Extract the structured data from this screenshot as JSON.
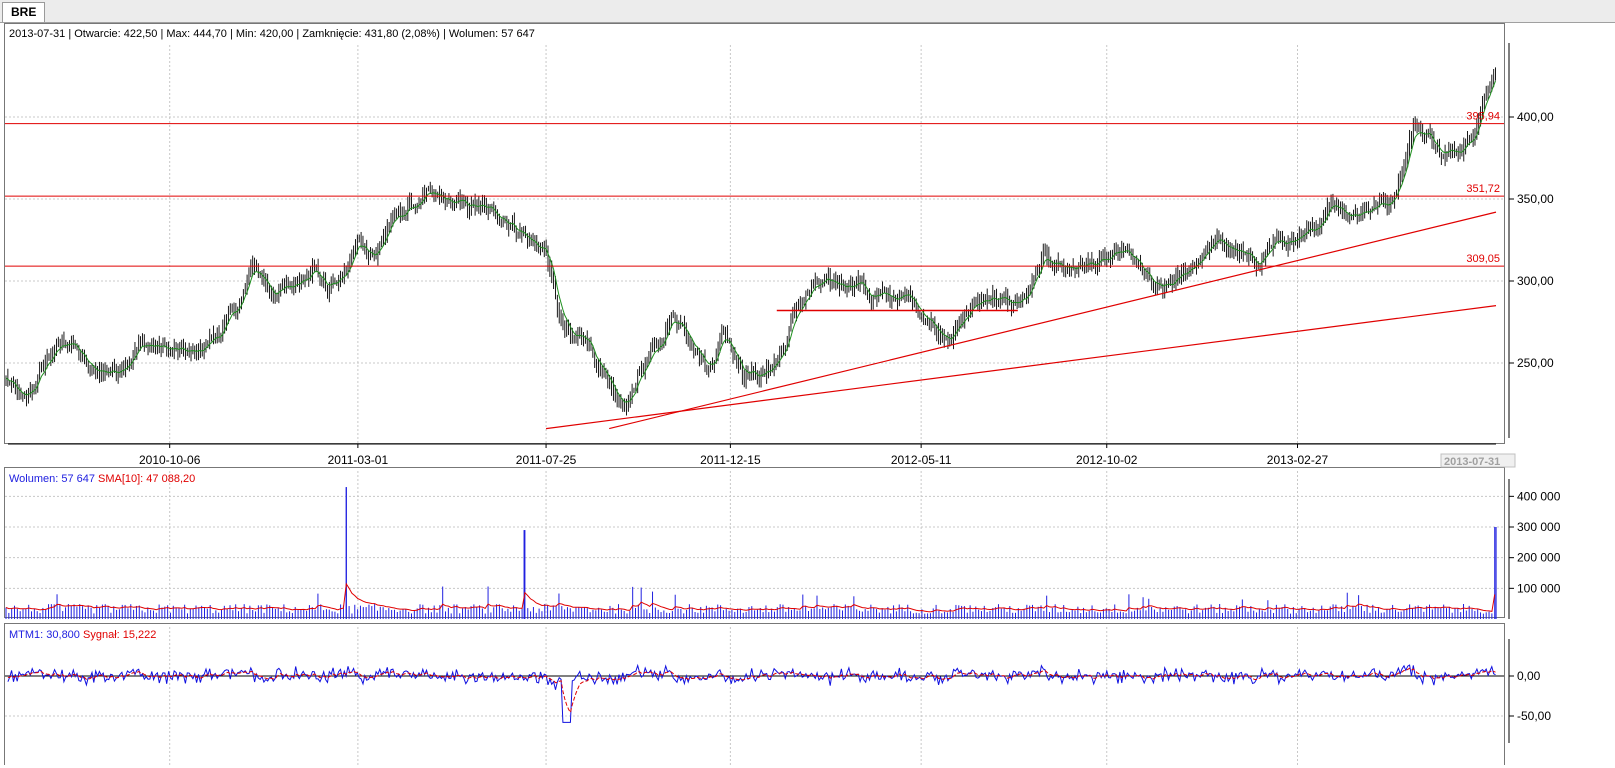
{
  "tab": {
    "label": "BRE"
  },
  "header": {
    "info": "2013-07-31 | Otwarcie: 422,50 | Max: 444,70 | Min: 420,00 | Zamknięcie: 431,80 (2,08%)  | Wolumen: 57 647"
  },
  "colors": {
    "candle": "#000000",
    "ma_line": "#1e8f1e",
    "level_lines": "#e00000",
    "volume": "#2020e0",
    "sma": "#e00000",
    "mtm": "#1010e0",
    "signal": "#e00000"
  },
  "chart_data": [
    {
      "type": "candlestick",
      "x_ticks": [
        "2010-10-06",
        "2011-03-01",
        "2011-07-25",
        "2011-12-15",
        "2012-05-11",
        "2012-10-02",
        "2013-02-27"
      ],
      "last_date_label": "2013-07-31",
      "y_ticks": [
        "250,00",
        "300,00",
        "350,00",
        "400,00"
      ],
      "ylim": [
        210,
        455
      ],
      "horizontal_levels": [
        {
          "label": "395,94",
          "value": 395.94
        },
        {
          "label": "351,72",
          "value": 351.72
        },
        {
          "label": "309,05",
          "value": 309.05
        }
      ],
      "support_segment": {
        "from": "2012-01-20",
        "to": "2012-07-25",
        "value": 282
      },
      "trendlines": [
        {
          "from": [
            "2011-09-12",
            210
          ],
          "to": [
            "2013-07-31",
            342
          ]
        },
        {
          "from": [
            "2011-07-25",
            210
          ],
          "to": [
            "2013-07-31",
            285
          ]
        }
      ],
      "close_path": [
        [
          "2010-06-01",
          240
        ],
        [
          "2010-06-15",
          225
        ],
        [
          "2010-07-05",
          255
        ],
        [
          "2010-07-20",
          265
        ],
        [
          "2010-08-05",
          245
        ],
        [
          "2010-08-25",
          245
        ],
        [
          "2010-09-15",
          262
        ],
        [
          "2010-10-06",
          258
        ],
        [
          "2010-10-25",
          255
        ],
        [
          "2010-11-15",
          270
        ],
        [
          "2010-12-01",
          290
        ],
        [
          "2010-12-10",
          310
        ],
        [
          "2010-12-25",
          292
        ],
        [
          "2011-01-10",
          297
        ],
        [
          "2011-01-25",
          310
        ],
        [
          "2011-02-05",
          295
        ],
        [
          "2011-02-20",
          305
        ],
        [
          "2011-03-01",
          325
        ],
        [
          "2011-03-15",
          315
        ],
        [
          "2011-03-25",
          335
        ],
        [
          "2011-04-10",
          345
        ],
        [
          "2011-04-25",
          352
        ],
        [
          "2011-05-10",
          348
        ],
        [
          "2011-06-01",
          345
        ],
        [
          "2011-06-20",
          340
        ],
        [
          "2011-07-05",
          330
        ],
        [
          "2011-07-15",
          322
        ],
        [
          "2011-07-25",
          318
        ],
        [
          "2011-08-05",
          275
        ],
        [
          "2011-08-15",
          262
        ],
        [
          "2011-08-25",
          268
        ],
        [
          "2011-09-05",
          245
        ],
        [
          "2011-09-15",
          228
        ],
        [
          "2011-09-25",
          222
        ],
        [
          "2011-10-05",
          245
        ],
        [
          "2011-10-20",
          260
        ],
        [
          "2011-11-01",
          280
        ],
        [
          "2011-11-15",
          265
        ],
        [
          "2011-11-28",
          245
        ],
        [
          "2011-12-10",
          270
        ],
        [
          "2011-12-25",
          245
        ],
        [
          "2012-01-10",
          242
        ],
        [
          "2012-01-25",
          258
        ],
        [
          "2012-02-05",
          285
        ],
        [
          "2012-02-20",
          298
        ],
        [
          "2012-03-10",
          298
        ],
        [
          "2012-03-25",
          300
        ],
        [
          "2012-04-01",
          290
        ],
        [
          "2012-04-15",
          290
        ],
        [
          "2012-05-01",
          290
        ],
        [
          "2012-05-11",
          282
        ],
        [
          "2012-05-25",
          268
        ],
        [
          "2012-06-05",
          268
        ],
        [
          "2012-06-20",
          285
        ],
        [
          "2012-07-05",
          292
        ],
        [
          "2012-07-20",
          285
        ],
        [
          "2012-08-01",
          290
        ],
        [
          "2012-08-15",
          315
        ],
        [
          "2012-09-01",
          308
        ],
        [
          "2012-09-15",
          310
        ],
        [
          "2012-10-02",
          312
        ],
        [
          "2012-10-15",
          318
        ],
        [
          "2012-10-25",
          310
        ],
        [
          "2012-11-10",
          293
        ],
        [
          "2012-11-25",
          300
        ],
        [
          "2012-12-10",
          312
        ],
        [
          "2012-12-25",
          325
        ],
        [
          "2013-01-10",
          318
        ],
        [
          "2013-01-25",
          310
        ],
        [
          "2013-02-10",
          325
        ],
        [
          "2013-02-27",
          322
        ],
        [
          "2013-03-15",
          335
        ],
        [
          "2013-03-25",
          350
        ],
        [
          "2013-04-10",
          340
        ],
        [
          "2013-04-25",
          345
        ],
        [
          "2013-05-10",
          348
        ],
        [
          "2013-05-20",
          370
        ],
        [
          "2013-05-28",
          395
        ],
        [
          "2013-06-10",
          388
        ],
        [
          "2013-06-20",
          375
        ],
        [
          "2013-07-01",
          380
        ],
        [
          "2013-07-15",
          395
        ],
        [
          "2013-07-31",
          432
        ]
      ]
    },
    {
      "type": "bar",
      "title": "Wolumen: 57 647",
      "sma_label": "SMA[10]: 47 088,20",
      "y_ticks": [
        "100 000",
        "200 000",
        "300 000",
        "400 000"
      ],
      "ylim": [
        0,
        450000
      ],
      "spikes": [
        {
          "date": "2011-02-20",
          "value": 430000
        },
        {
          "date": "2011-07-08",
          "value": 290000
        },
        {
          "date": "2013-07-31",
          "value": 300000
        }
      ],
      "baseline_level": 35000
    },
    {
      "type": "line",
      "title": "MTM1: 30,800",
      "signal_label": "Sygnał: 15,222",
      "y_ticks": [
        "0,00",
        "-50,00"
      ],
      "ylim": [
        -65,
        45
      ],
      "series": [
        {
          "name": "MTM1",
          "values_hint": "oscillates around 0"
        },
        {
          "name": "Sygnał",
          "values_hint": "smoothed MTM1"
        }
      ]
    }
  ]
}
